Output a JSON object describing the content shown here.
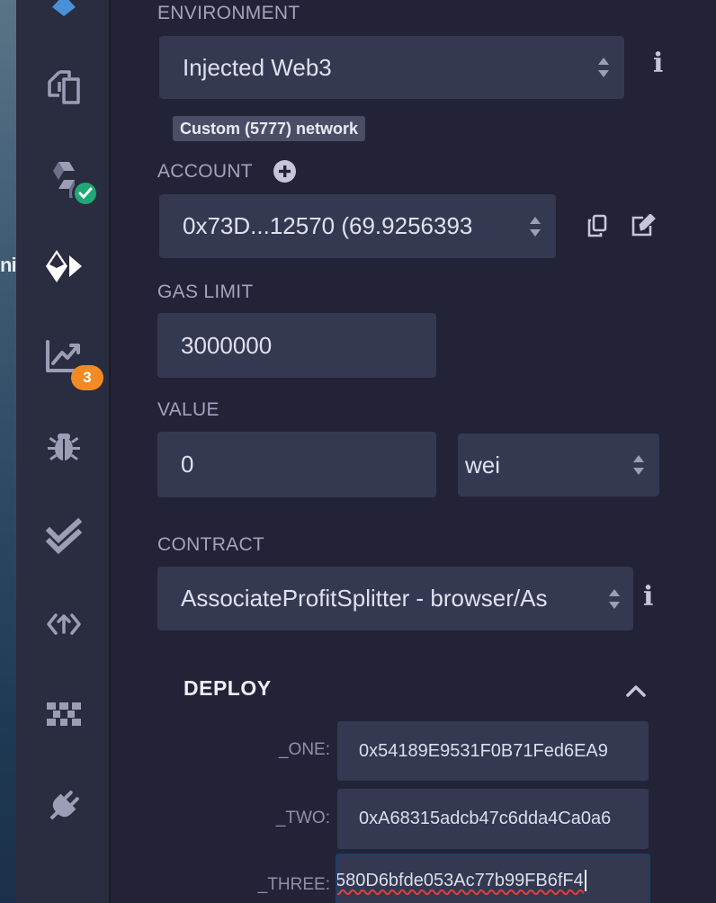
{
  "desktop_fragment": "ni",
  "sidebar": {
    "icons": [
      {
        "name": "ethereum-logo-icon"
      },
      {
        "name": "file-explorer-icon"
      },
      {
        "name": "solidity-compiler-icon",
        "status": "compiled-success"
      },
      {
        "name": "deploy-run-icon",
        "active": true
      },
      {
        "name": "analysis-icon",
        "badge": "3"
      },
      {
        "name": "debugger-icon"
      },
      {
        "name": "unit-testing-icon"
      },
      {
        "name": "plugin-manager-icon"
      },
      {
        "name": "provable-icon"
      },
      {
        "name": "settings-plug-icon"
      }
    ],
    "badge_color": "#f28b24",
    "check_color": "#1fa875"
  },
  "environment": {
    "label": "ENVIRONMENT",
    "value": "Injected Web3",
    "network": "Custom (5777) network"
  },
  "account": {
    "label": "ACCOUNT",
    "value": "0x73D...12570 (69.9256393"
  },
  "gas_limit": {
    "label": "GAS LIMIT",
    "value": "3000000"
  },
  "value": {
    "label": "VALUE",
    "amount": "0",
    "unit": "wei"
  },
  "contract": {
    "label": "CONTRACT",
    "value": "AssociateProfitSplitter - browser/As"
  },
  "deploy": {
    "title": "DEPLOY",
    "params": [
      {
        "label": "_ONE:",
        "value": "0x54189E9531F0B71Fed6EA9"
      },
      {
        "label": "_TWO:",
        "value": "0xA68315adcb47c6dda4Ca0a6"
      },
      {
        "label": "_THREE:",
        "value": "580D6bfde053Ac77b99FB6fF4"
      }
    ]
  }
}
